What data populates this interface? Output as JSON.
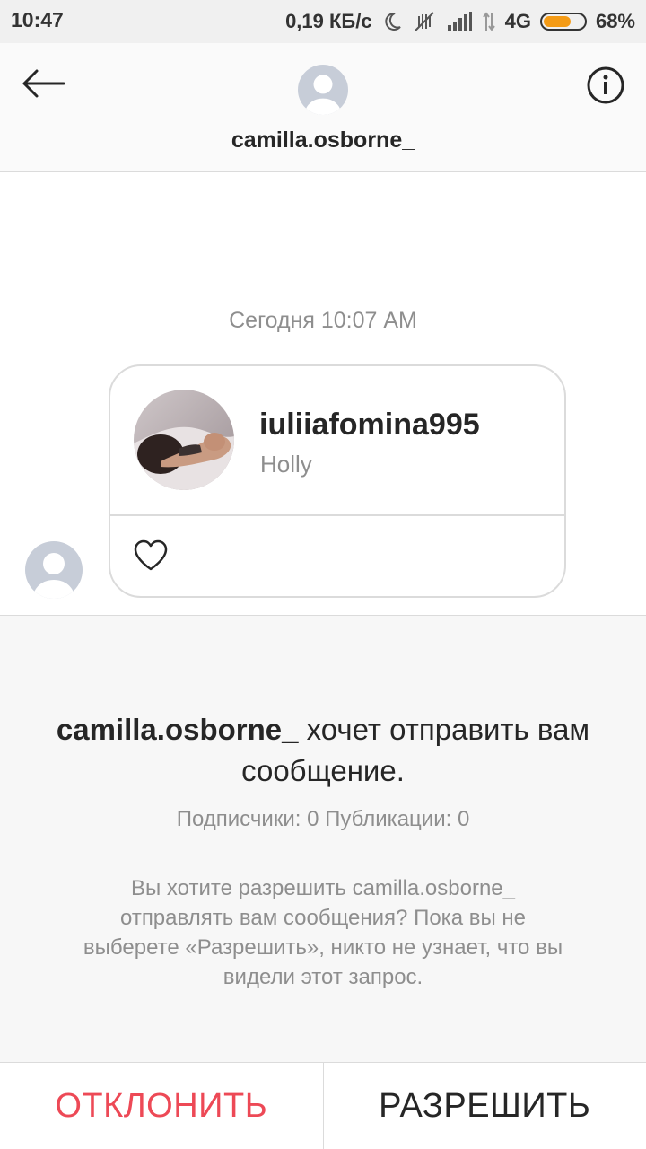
{
  "status_bar": {
    "time": "10:47",
    "network_speed": "0,19 КБ/с",
    "network_type": "4G",
    "battery": "68%",
    "battery_level": 0.68,
    "battery_color": "#f49b16",
    "icons": [
      "moon-icon",
      "mute-vibrate-icon",
      "signal-icon",
      "data-arrows-icon",
      "battery-icon"
    ]
  },
  "header": {
    "title": "camilla.osborne_",
    "back_icon": "arrow-left-icon",
    "info_icon": "info-circle-icon"
  },
  "thread": {
    "date_stamp": "Сегодня 10:07 AM",
    "shared_profile": {
      "username": "iuliiafomina995",
      "subtitle": "Holly"
    },
    "like_icon": "heart-outline-icon"
  },
  "request": {
    "title_username": "camilla.osborne_",
    "title_rest": "хочет отправить вам сообщение.",
    "stats": "Подписчики: 0 Публикации: 0",
    "description": "Вы хотите разрешить camilla.osborne_ отправлять вам сообщения? Пока вы не выберете «Разрешить», никто не узнает, что вы видели этот запрос."
  },
  "actions": {
    "decline_label": "ОТКЛОНИТЬ",
    "allow_label": "РАЗРЕШИТЬ",
    "decline_color": "#ed4956"
  }
}
